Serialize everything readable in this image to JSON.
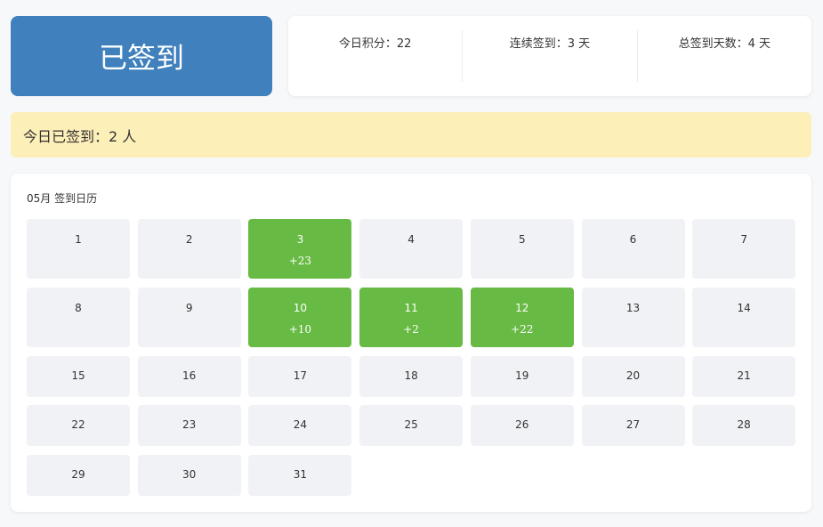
{
  "checkin": {
    "label": "已签到"
  },
  "stats": {
    "today_points": "今日积分：22",
    "streak": "连续签到：3 天",
    "total": "总签到天数：4 天"
  },
  "notice": {
    "text": "今日已签到：2 人"
  },
  "calendar": {
    "title": "05月 签到日历",
    "days": [
      {
        "day": "1",
        "points": ""
      },
      {
        "day": "2",
        "points": ""
      },
      {
        "day": "3",
        "points": "+23"
      },
      {
        "day": "4",
        "points": ""
      },
      {
        "day": "5",
        "points": ""
      },
      {
        "day": "6",
        "points": ""
      },
      {
        "day": "7",
        "points": ""
      },
      {
        "day": "8",
        "points": ""
      },
      {
        "day": "9",
        "points": ""
      },
      {
        "day": "10",
        "points": "+10"
      },
      {
        "day": "11",
        "points": "+2"
      },
      {
        "day": "12",
        "points": "+22"
      },
      {
        "day": "13",
        "points": ""
      },
      {
        "day": "14",
        "points": ""
      },
      {
        "day": "15",
        "points": ""
      },
      {
        "day": "16",
        "points": ""
      },
      {
        "day": "17",
        "points": ""
      },
      {
        "day": "18",
        "points": ""
      },
      {
        "day": "19",
        "points": ""
      },
      {
        "day": "20",
        "points": ""
      },
      {
        "day": "21",
        "points": ""
      },
      {
        "day": "22",
        "points": ""
      },
      {
        "day": "23",
        "points": ""
      },
      {
        "day": "24",
        "points": ""
      },
      {
        "day": "25",
        "points": ""
      },
      {
        "day": "26",
        "points": ""
      },
      {
        "day": "27",
        "points": ""
      },
      {
        "day": "28",
        "points": ""
      },
      {
        "day": "29",
        "points": ""
      },
      {
        "day": "30",
        "points": ""
      },
      {
        "day": "31",
        "points": ""
      }
    ]
  },
  "colors": {
    "checkin_bg": "#3f80bd",
    "signed_day": "#67ba43",
    "unsigned_day": "#f1f2f5",
    "notice_bg": "#fdefb8"
  }
}
